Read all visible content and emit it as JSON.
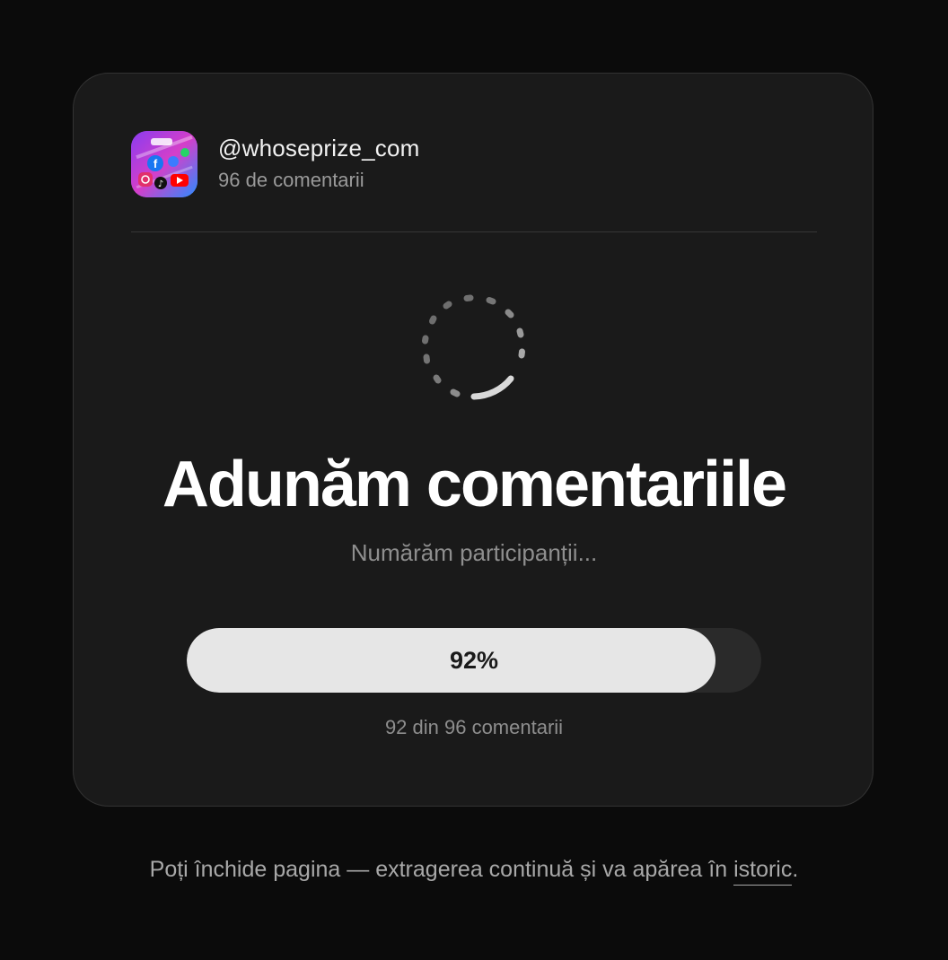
{
  "account": {
    "handle": "@whoseprize_com",
    "comments_label": "96 de comentarii",
    "avatar_icon": "social-media-collage-icon"
  },
  "status": {
    "title": "Adunăm comentariile",
    "subtitle": "Numărăm participanții...",
    "spinner_icon": "loading-spinner-icon"
  },
  "progress": {
    "percent": 92,
    "percent_label": "92%",
    "count_label": "92 din 96 comentarii"
  },
  "footer": {
    "text_before": "Poți închide pagina — extragerea continuă și va apărea în ",
    "link_label": "istoric",
    "text_after": "."
  },
  "colors": {
    "background": "#0b0b0b",
    "card": "#1a1a1a",
    "progress_fill": "#e6e6e6",
    "progress_track": "#2a2a2a"
  }
}
